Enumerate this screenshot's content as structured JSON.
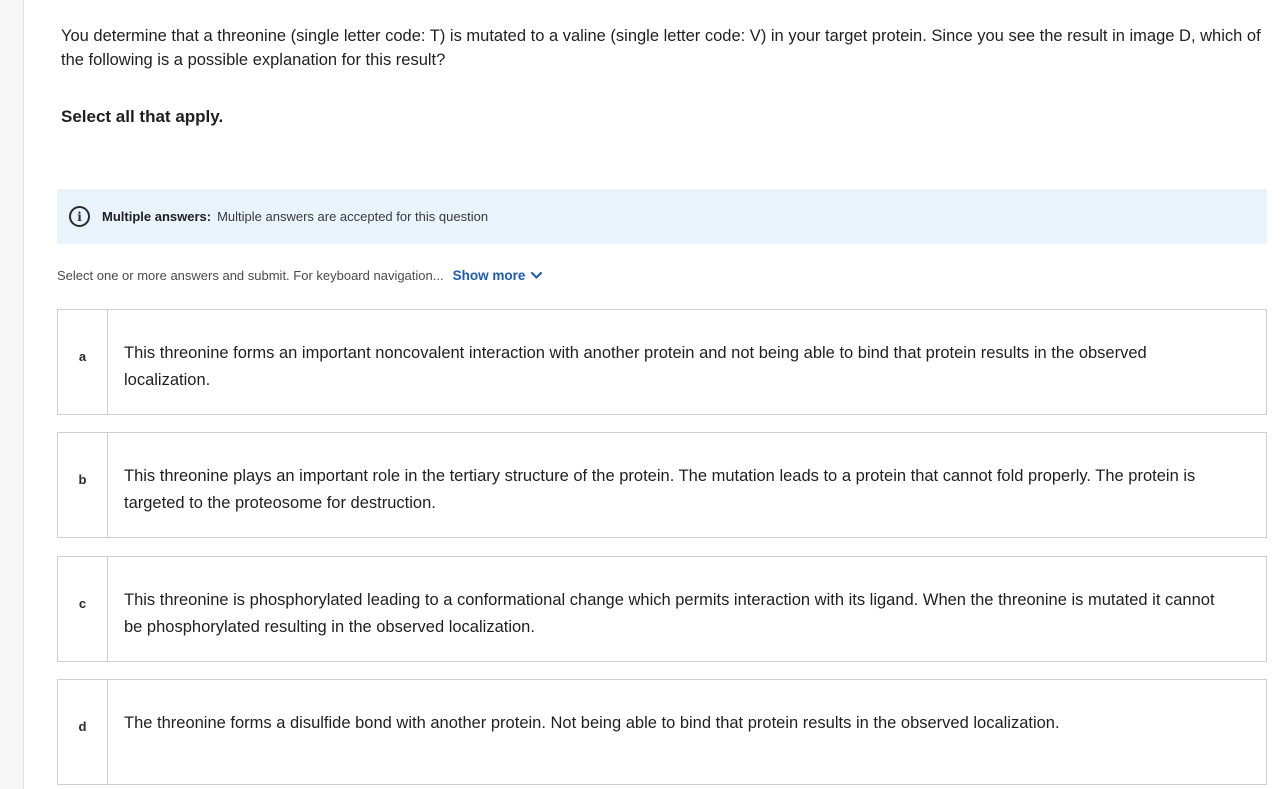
{
  "question": {
    "text": "You determine that a threonine (single letter code: T) is mutated to a valine (single letter code: V) in your target protein. Since you see the result in image D, which of the following is a possible explanation for this result?",
    "instruction": "Select all that apply."
  },
  "banner": {
    "icon": "info-icon",
    "title": "Multiple answers:",
    "text": "Multiple answers are accepted for this question"
  },
  "helper": {
    "text": "Select one or more answers and submit. For keyboard navigation...",
    "show_more": "Show more",
    "show_more_icon": "chevron-down-icon",
    "link_color": "#1d5bb5"
  },
  "options": [
    {
      "letter": "a",
      "text": "This threonine forms an important noncovalent interaction with another protein and not being able to bind that protein results in the observed localization."
    },
    {
      "letter": "b",
      "text": "This threonine plays an important role in the tertiary structure of the protein. The mutation leads to a protein that cannot fold properly. The protein is targeted to the proteosome for destruction."
    },
    {
      "letter": "c",
      "text": "This threonine is phosphorylated leading to a conformational change which permits interaction with its ligand. When the threonine is mutated it cannot be phosphorylated resulting in the observed localization."
    },
    {
      "letter": "d",
      "text": "The threonine forms a disulfide bond with another protein. Not being able to bind that protein results in the observed localization."
    }
  ]
}
